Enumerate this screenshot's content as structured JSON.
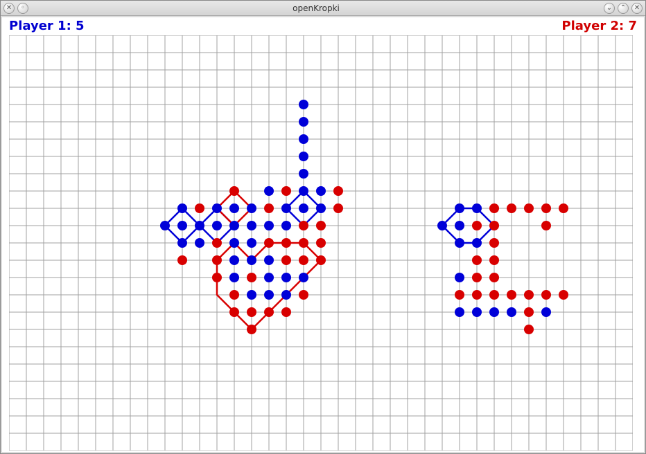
{
  "window": {
    "title": "openKropki"
  },
  "scores": {
    "p1_label": "Player 1:",
    "p1_score": "5",
    "p2_label": "Player 2:",
    "p2_score": "7"
  },
  "colors": {
    "p1": "#0000d8",
    "p2": "#d80000",
    "grid": "#a0a0a0"
  },
  "board": {
    "cols": 36,
    "rows": 24,
    "cell": 25,
    "dot_r": 7,
    "dots_p1": [
      [
        17,
        4
      ],
      [
        17,
        5
      ],
      [
        17,
        6
      ],
      [
        17,
        7
      ],
      [
        17,
        8
      ],
      [
        15,
        9
      ],
      [
        17,
        9
      ],
      [
        18,
        9
      ],
      [
        10,
        10
      ],
      [
        12,
        10
      ],
      [
        13,
        10
      ],
      [
        14,
        10
      ],
      [
        16,
        10
      ],
      [
        17,
        10
      ],
      [
        18,
        10
      ],
      [
        9,
        11
      ],
      [
        10,
        11
      ],
      [
        11,
        11
      ],
      [
        12,
        11
      ],
      [
        13,
        11
      ],
      [
        14,
        11
      ],
      [
        15,
        11
      ],
      [
        16,
        11
      ],
      [
        10,
        12
      ],
      [
        11,
        12
      ],
      [
        13,
        12
      ],
      [
        14,
        12
      ],
      [
        13,
        13
      ],
      [
        14,
        13
      ],
      [
        15,
        13
      ],
      [
        13,
        14
      ],
      [
        15,
        14
      ],
      [
        16,
        14
      ],
      [
        17,
        14
      ],
      [
        14,
        15
      ],
      [
        15,
        15
      ],
      [
        16,
        15
      ],
      [
        26,
        10
      ],
      [
        27,
        10
      ],
      [
        25,
        11
      ],
      [
        26,
        11
      ],
      [
        26,
        12
      ],
      [
        27,
        12
      ],
      [
        26,
        14
      ],
      [
        26,
        16
      ],
      [
        27,
        16
      ],
      [
        28,
        16
      ],
      [
        29,
        16
      ],
      [
        31,
        16
      ]
    ],
    "dots_p2": [
      [
        13,
        9
      ],
      [
        16,
        9
      ],
      [
        19,
        9
      ],
      [
        11,
        10
      ],
      [
        15,
        10
      ],
      [
        19,
        10
      ],
      [
        17,
        11
      ],
      [
        18,
        11
      ],
      [
        12,
        12
      ],
      [
        15,
        12
      ],
      [
        16,
        12
      ],
      [
        17,
        12
      ],
      [
        18,
        12
      ],
      [
        10,
        13
      ],
      [
        12,
        13
      ],
      [
        16,
        13
      ],
      [
        17,
        13
      ],
      [
        18,
        13
      ],
      [
        12,
        14
      ],
      [
        14,
        14
      ],
      [
        13,
        15
      ],
      [
        17,
        15
      ],
      [
        13,
        16
      ],
      [
        14,
        16
      ],
      [
        15,
        16
      ],
      [
        16,
        16
      ],
      [
        14,
        17
      ],
      [
        28,
        10
      ],
      [
        29,
        10
      ],
      [
        30,
        10
      ],
      [
        31,
        10
      ],
      [
        32,
        10
      ],
      [
        27,
        11
      ],
      [
        28,
        11
      ],
      [
        31,
        11
      ],
      [
        28,
        12
      ],
      [
        27,
        13
      ],
      [
        28,
        13
      ],
      [
        27,
        14
      ],
      [
        28,
        14
      ],
      [
        26,
        15
      ],
      [
        27,
        15
      ],
      [
        28,
        15
      ],
      [
        29,
        15
      ],
      [
        30,
        15
      ],
      [
        31,
        15
      ],
      [
        32,
        15
      ],
      [
        30,
        16
      ],
      [
        30,
        17
      ]
    ],
    "paths_p1": [
      [
        [
          10,
          10
        ],
        [
          11,
          11
        ],
        [
          10,
          12
        ],
        [
          9,
          11
        ],
        [
          10,
          10
        ]
      ],
      [
        [
          12,
          10
        ],
        [
          13,
          11
        ],
        [
          12,
          12
        ],
        [
          11,
          11
        ],
        [
          12,
          10
        ]
      ],
      [
        [
          17,
          9
        ],
        [
          18,
          10
        ],
        [
          17,
          11
        ],
        [
          16,
          10
        ],
        [
          17,
          9
        ]
      ],
      [
        [
          26,
          10
        ],
        [
          27,
          10
        ],
        [
          28,
          11
        ],
        [
          27,
          12
        ],
        [
          26,
          12
        ],
        [
          25,
          11
        ],
        [
          26,
          10
        ]
      ]
    ],
    "paths_p2": [
      [
        [
          13,
          9
        ],
        [
          14,
          10
        ],
        [
          13,
          11
        ],
        [
          12,
          10
        ],
        [
          13,
          9
        ]
      ],
      [
        [
          15,
          12
        ],
        [
          16,
          12
        ],
        [
          17,
          12
        ],
        [
          18,
          13
        ],
        [
          17,
          14
        ],
        [
          16,
          15
        ],
        [
          15,
          16
        ],
        [
          14,
          17
        ],
        [
          13,
          16
        ],
        [
          12,
          15
        ],
        [
          12,
          14
        ],
        [
          12,
          13
        ],
        [
          13,
          12
        ],
        [
          14,
          13
        ],
        [
          15,
          12
        ]
      ]
    ]
  }
}
